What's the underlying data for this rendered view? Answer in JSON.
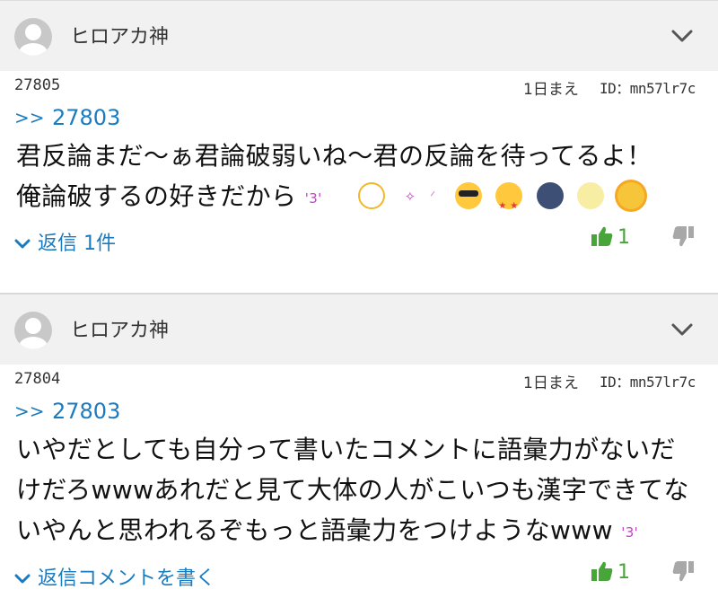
{
  "comments": [
    {
      "username": "ヒロアカ神",
      "number": "27805",
      "time_ago": "1日まえ",
      "user_id": "ID：mn57lr7c",
      "reply_prefix": ">>",
      "reply_to": "27803",
      "body_lines": [
        "君反論まだ〜ぁ君論破弱いね〜君の反論を待ってるよ！",
        "俺論破するの好きだから"
      ],
      "small_emoticon": "'3'",
      "emojis": [
        "smiling-face-icon",
        "wink-emoticon-icon",
        "wink-emoticon-icon",
        "sunglasses-face-icon",
        "star-struck-face-icon",
        "new-moon-face-icon",
        "full-moon-face-icon",
        "sun-face-icon"
      ],
      "replies_label": "返信 1件",
      "likes": "1"
    },
    {
      "username": "ヒロアカ神",
      "number": "27804",
      "time_ago": "1日まえ",
      "user_id": "ID：mn57lr7c",
      "reply_prefix": ">>",
      "reply_to": "27803",
      "body_lines": [
        "いやだとしても自分って書いたコメントに語彙力がないだ",
        "けだろwwwあれだと見て大体の人がこいつも漢字できてな",
        "いやんと思われるぞもっと語彙力をつけようなwww"
      ],
      "small_emoticon": "'3'",
      "replies_label": "返信コメントを書く",
      "likes": "1"
    }
  ],
  "colors": {
    "link": "#1a7bbf",
    "like": "#48a53a",
    "header_bg": "#f1f1f1"
  }
}
